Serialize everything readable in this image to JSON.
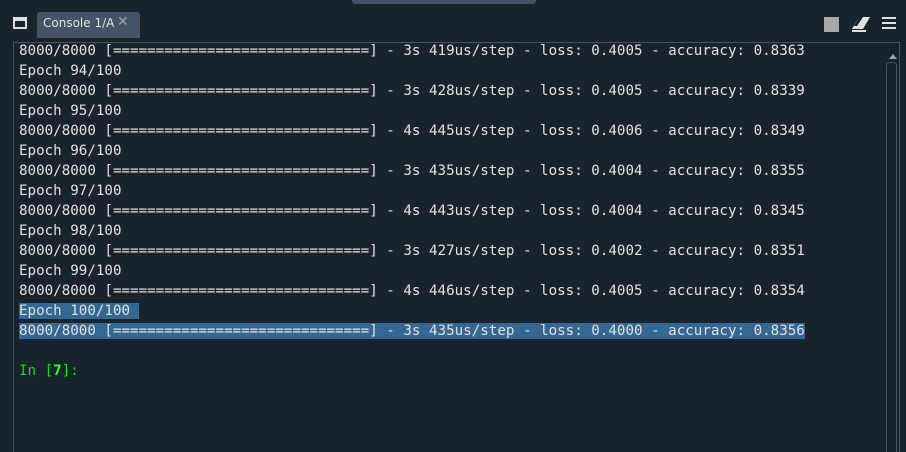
{
  "tab": {
    "label": "Console 1/A",
    "close_glyph": "✕"
  },
  "toolbar": {
    "icons": [
      "pane-layout-icon",
      "stop-icon",
      "eraser-icon",
      "menu-icon"
    ]
  },
  "console": {
    "lines": [
      "8000/8000 [==============================] - 3s 419us/step - loss: 0.4005 - accuracy: 0.8363",
      "Epoch 94/100",
      "8000/8000 [==============================] - 3s 428us/step - loss: 0.4005 - accuracy: 0.8339",
      "Epoch 95/100",
      "8000/8000 [==============================] - 4s 445us/step - loss: 0.4006 - accuracy: 0.8349",
      "Epoch 96/100",
      "8000/8000 [==============================] - 3s 435us/step - loss: 0.4004 - accuracy: 0.8355",
      "Epoch 97/100",
      "8000/8000 [==============================] - 4s 443us/step - loss: 0.4004 - accuracy: 0.8345",
      "Epoch 98/100",
      "8000/8000 [==============================] - 3s 427us/step - loss: 0.4002 - accuracy: 0.8351",
      "Epoch 99/100",
      "8000/8000 [==============================] - 4s 446us/step - loss: 0.4005 - accuracy: 0.8354",
      "Epoch 100/100 ",
      "8000/8000 [==============================] - 3s 435us/step - loss: 0.4000 - accuracy: 0.8356"
    ],
    "selected_from": 13,
    "prompt": {
      "prefix": "In [",
      "number": "7",
      "suffix": "]:"
    }
  },
  "colors": {
    "background": "#19232d",
    "tab_bg": "#455364",
    "text": "#e0e1e3",
    "selection": "#346792",
    "prompt": "#00e400"
  }
}
